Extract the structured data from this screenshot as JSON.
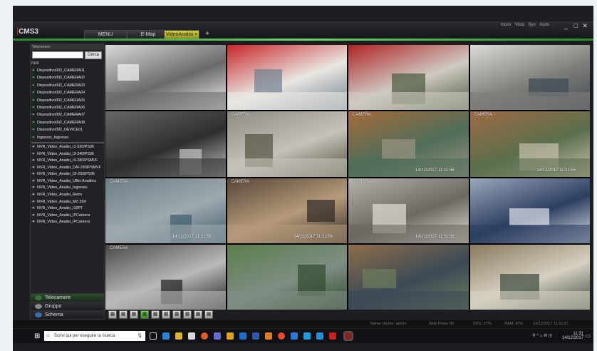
{
  "app": {
    "title": "CMS3",
    "tabs": [
      {
        "label": "MENU"
      },
      {
        "label": "E-Map"
      },
      {
        "label": "VideoAnalisi"
      }
    ],
    "add_tab_label": "+",
    "top_menu": [
      "Inizio",
      "Vista",
      "Sys",
      "Aiuto"
    ],
    "window_buttons": {
      "minimize": "_",
      "maximize": "□",
      "close": "✕"
    }
  },
  "sidebar": {
    "header_label": "Telecamere",
    "search_button": "Cerca",
    "search_value": "",
    "root_label": "root",
    "devices": [
      "Dispositivo002_CAMERA01",
      "Dispositivo002_CAMERA02",
      "Dispositivo002_CAMERA03",
      "Dispositivo002_CAMERA04",
      "Dispositivo002_CAMERA05",
      "Dispositivo002_CAMERA06",
      "Dispositivo002_CAMERA07",
      "Dispositivo002_CAMERA08",
      "Dispositivo002_DEVICE01",
      "Ingresso_Ingresso"
    ],
    "nvr_items": [
      "NVR_Video_Analisi_I1-330IPS36",
      "NVR_Video_Analisi_I3-340IPS36",
      "NVR_Video_Analisi_I4-280IPSMVF",
      "NVR_Video_Analisi_DAI-280IPSMVF",
      "NVR_Video_Analisi_DI-250IPS36",
      "NVR_Video_Analisi_Uffici Analitics",
      "NVR_Video_Analisi_Ingresso",
      "NVR_Video_Analisi_Retro",
      "NVR_Video_Analisi_MZ-20X",
      "NVR_Video_Analisi_I10PT",
      "NVR_Video_Analisi_IPCamera",
      "NVR_Video_Analisi_IPCamera"
    ],
    "bottom_buttons": [
      "Telecamere",
      "Gruppo",
      "Schema"
    ]
  },
  "cameras": [
    {
      "label": "",
      "timestamp": "",
      "palette": [
        "#d9d9d9",
        "#6a6a6a",
        "#f3f3f3"
      ]
    },
    {
      "label": "",
      "timestamp": "",
      "palette": [
        "#c8262a",
        "#e9e7e2",
        "#6f7f8e"
      ]
    },
    {
      "label": "",
      "timestamp": "",
      "palette": [
        "#b02424",
        "#cfcac3",
        "#4c5a3c"
      ]
    },
    {
      "label": "",
      "timestamp": "",
      "palette": [
        "#dcdcd6",
        "#7e7f7a",
        "#3f4a55"
      ]
    },
    {
      "label": "",
      "timestamp": "",
      "palette": [
        "#676767",
        "#2e2e2e",
        "#c4c4c4"
      ]
    },
    {
      "label": "CAMERA",
      "timestamp": "",
      "palette": [
        "#8c8a82",
        "#c4c2ba",
        "#55513f"
      ]
    },
    {
      "label": "CAMERA",
      "timestamp": "14/12/2017 11:31:56",
      "palette": [
        "#a66a3a",
        "#4f6e5a",
        "#9c9382"
      ]
    },
    {
      "label": "CAMERA",
      "timestamp": "14/12/2017 11:31:56",
      "palette": [
        "#9e6a45",
        "#5b6f4c",
        "#c9c1ad"
      ]
    },
    {
      "label": "CAMERA",
      "timestamp": "14/12/2017 11:31:56",
      "palette": [
        "#6d7d86",
        "#9ea9ae",
        "#3e5e6e"
      ]
    },
    {
      "label": "CAMERA",
      "timestamp": "14/12/2017 11:31:56",
      "palette": [
        "#574638",
        "#b69a7a",
        "#2e2a26"
      ]
    },
    {
      "label": "CAMERA",
      "timestamp": "14/12/2017 11:31:56",
      "palette": [
        "#b5b1ab",
        "#6c6862",
        "#e3dfd8"
      ]
    },
    {
      "label": "",
      "timestamp": "",
      "palette": [
        "#9aa8bd",
        "#2d3f60",
        "#dfe4ec"
      ]
    },
    {
      "label": "CAMERA",
      "timestamp": "",
      "palette": [
        "#4a4a4a",
        "#b9b9b9",
        "#1f1f1f"
      ]
    },
    {
      "label": "",
      "timestamp": "",
      "palette": [
        "#5a7e4a",
        "#7e8e84",
        "#304a2e"
      ]
    },
    {
      "label": "",
      "timestamp": "",
      "palette": [
        "#8e6e4a",
        "#3b4a56",
        "#6e7e5a"
      ]
    },
    {
      "label": "",
      "timestamp": "",
      "palette": [
        "#8a7a5e",
        "#d6d0c0",
        "#3a4a3e"
      ]
    }
  ],
  "toolbar_icons": [
    "1",
    "4",
    "9",
    "16",
    "25",
    "36",
    "64",
    "shot",
    "rec",
    "full"
  ],
  "statusbar": {
    "user": "Nome Utente: admin",
    "port": "Web Porta: 80",
    "cpu": "CPU: 27%",
    "ram": "RAM: 47%",
    "datetime": "14/12/2017 11:31:57"
  },
  "taskbar": {
    "search_placeholder": "Scrivi qui per eseguire la ricerca",
    "clock_time": "11:31",
    "clock_date": "14/12/2017"
  },
  "colors": {
    "accent_green": "#3fbf3f",
    "tab_active": "#d8d040",
    "brand_red": "#c61f1f"
  }
}
